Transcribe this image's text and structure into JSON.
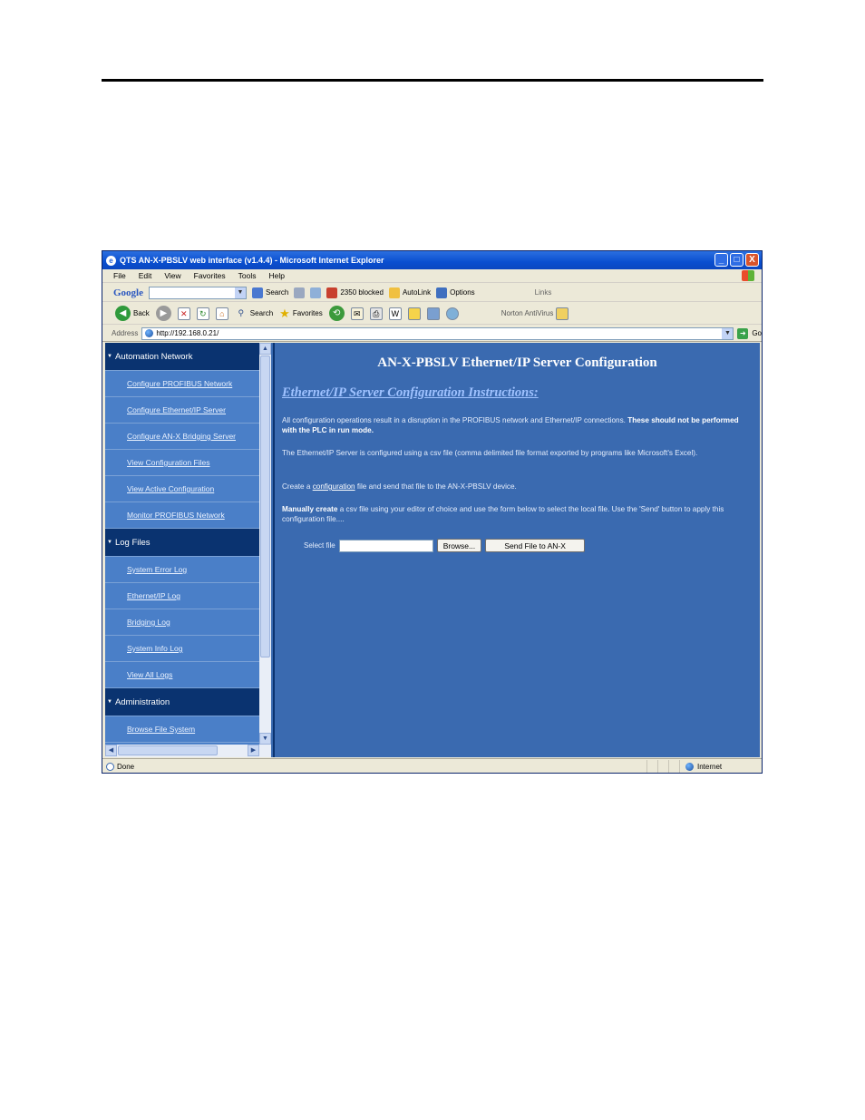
{
  "window": {
    "title": "QTS AN-X-PBSLV web interface (v1.4.4) - Microsoft Internet Explorer",
    "controls": [
      "_",
      "□",
      "X"
    ]
  },
  "menu": [
    "File",
    "Edit",
    "View",
    "Favorites",
    "Tools",
    "Help"
  ],
  "google_toolbar": {
    "logo": "Google",
    "search_label": "Search",
    "blocked_label": "2350 blocked",
    "autolink_label": "AutoLink",
    "options_label": "Options",
    "links_label": "Links"
  },
  "standard_toolbar": {
    "back_label": "Back",
    "search_label": "Search",
    "favorites_label": "Favorites",
    "norton_label": "Norton AntiVirus"
  },
  "address_bar": {
    "label": "Address",
    "url": "http://192.168.0.21/",
    "go_label": "Go"
  },
  "sidebar": {
    "sections": [
      {
        "title": "Automation Network",
        "items": [
          "Configure PROFIBUS Network",
          "Configure Ethernet/IP Server",
          "Configure AN-X Bridging Server",
          "View Configuration Files",
          "View Active Configuration",
          "Monitor PROFIBUS Network"
        ]
      },
      {
        "title": "Log Files",
        "items": [
          "System Error Log",
          "Ethernet/IP Log",
          "Bridging Log",
          "System Info Log",
          "View All Logs"
        ]
      },
      {
        "title": "Administration",
        "items": [
          "Browse File System"
        ]
      }
    ]
  },
  "main": {
    "title": "AN-X-PBSLV Ethernet/IP Server Configuration",
    "subtitle": "Ethernet/IP Server Configuration Instructions:",
    "para1_text": "All configuration operations result in a disruption in the PROFIBUS network and Ethernet/IP connections.",
    "para1_bold": "These should not be performed with the PLC in run mode.",
    "para2": "The Ethernet/IP Server is configured using a csv file (comma delimited file format exported by programs like Microsoft's Excel).",
    "para3_prefix": "Create a",
    "para3_link": "configuration",
    "para3_suffix": "file and send that file to the AN-X-PBSLV device.",
    "para4_bold": "Manually create",
    "para4_text": "a csv file using your editor of choice and use the form below to select the local file. Use the 'Send' button to apply this configuration file....",
    "select_file_label": "Select file",
    "browse_label": "Browse...",
    "send_label": "Send File to AN-X"
  },
  "status_bar": {
    "left": "Done",
    "zone": "Internet"
  }
}
